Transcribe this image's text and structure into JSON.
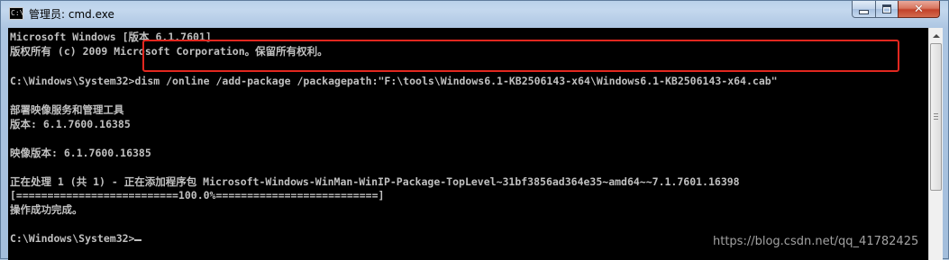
{
  "window": {
    "title": "管理员: cmd.exe",
    "controls": {
      "minimize": "minimize",
      "maximize": "maximize",
      "close": "✕"
    }
  },
  "console": {
    "lines": [
      "Microsoft Windows [版本 6.1.7601]",
      "版权所有 (c) 2009 Microsoft Corporation。保留所有权利。",
      "",
      "C:\\Windows\\System32>dism /online /add-package /packagepath:\"F:\\tools\\Windows6.1-KB2506143-x64\\Windows6.1-KB2506143-x64.cab\"",
      "",
      "部署映像服务和管理工具",
      "版本: 6.1.7600.16385",
      "",
      "映像版本: 6.1.7600.16385",
      "",
      "正在处理 1 (共 1) - 正在添加程序包 Microsoft-Windows-WinMan-WinIP-Package-TopLevel~31bf3856ad364e35~amd64~~7.1.7601.16398",
      "[==========================100.0%==========================]",
      "操作成功完成。",
      "",
      "C:\\Windows\\System32>"
    ]
  },
  "annotation": {
    "highlight_color": "#e2271f"
  },
  "watermark": "https://blog.csdn.net/qq_41782425",
  "colors": {
    "console_bg": "#000000",
    "console_fg": "#c0c0c0",
    "title_bar": "#b9d1ea"
  }
}
